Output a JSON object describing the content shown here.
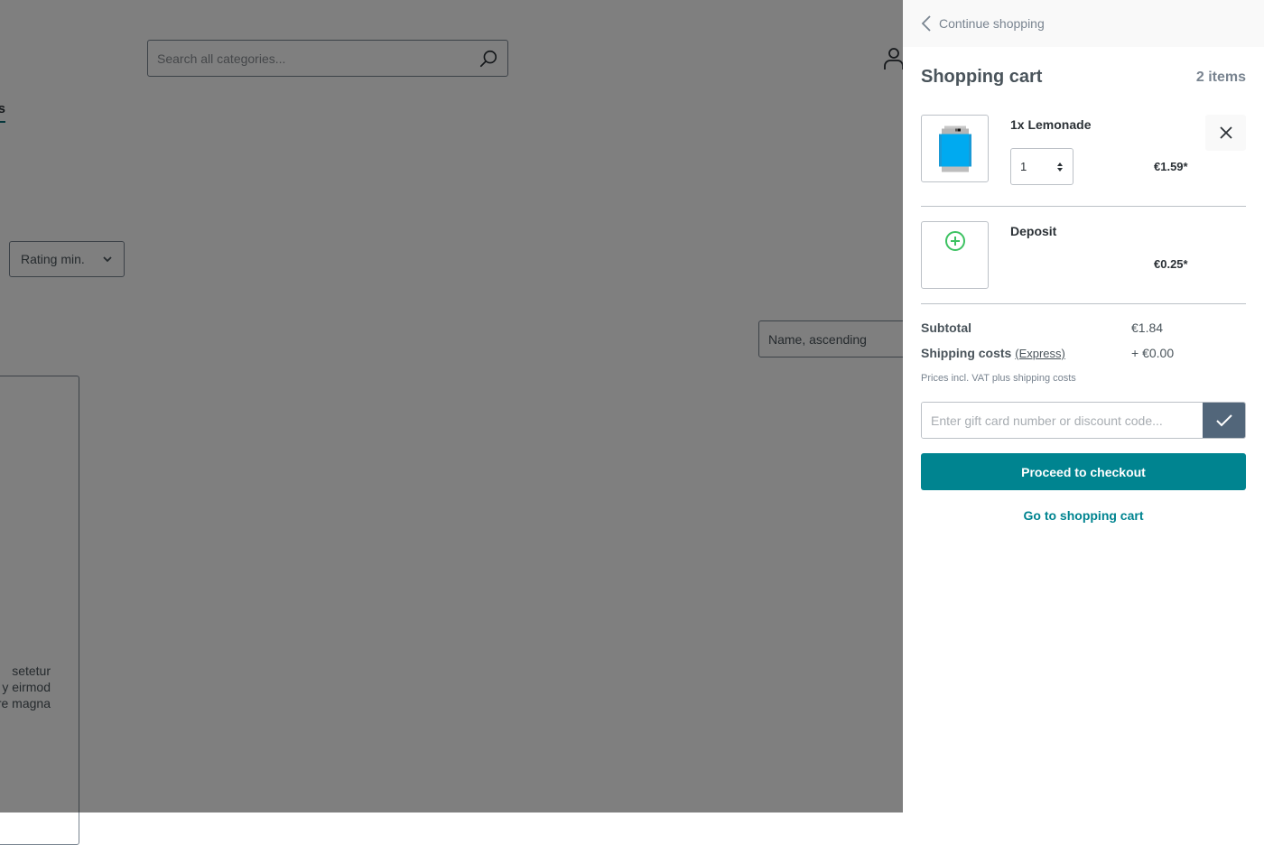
{
  "background": {
    "search": {
      "placeholder": "Search all categories..."
    },
    "nav_partial_label": "s",
    "rating_filter_label": "Rating min.",
    "sort_select_value": "Name, ascending",
    "product_description_lines": [
      "setetur",
      "y eirmod",
      "re magna"
    ]
  },
  "cart": {
    "continue_label": "Continue shopping",
    "title": "Shopping cart",
    "item_count": "2 items",
    "line_items": [
      {
        "name": "1x Lemonade",
        "quantity": "1",
        "price": "€1.59*",
        "image": "lemonade-can"
      },
      {
        "name": "Deposit",
        "price": "€0.25*",
        "image": "plus-circle-icon"
      }
    ],
    "summary": {
      "subtotal_label": "Subtotal",
      "subtotal_value": "€1.84",
      "shipping_label": "Shipping costs",
      "shipping_method": "(Express)",
      "shipping_value": "+ €0.00"
    },
    "vat_note": "Prices incl. VAT plus shipping costs",
    "promo_placeholder": "Enter gift card number or discount code...",
    "checkout_label": "Proceed to checkout",
    "go_to_cart_label": "Go to shopping cart",
    "colors": {
      "primary": "#008490",
      "promo_button": "#52667a",
      "deposit_icon": "#3cc261"
    }
  }
}
